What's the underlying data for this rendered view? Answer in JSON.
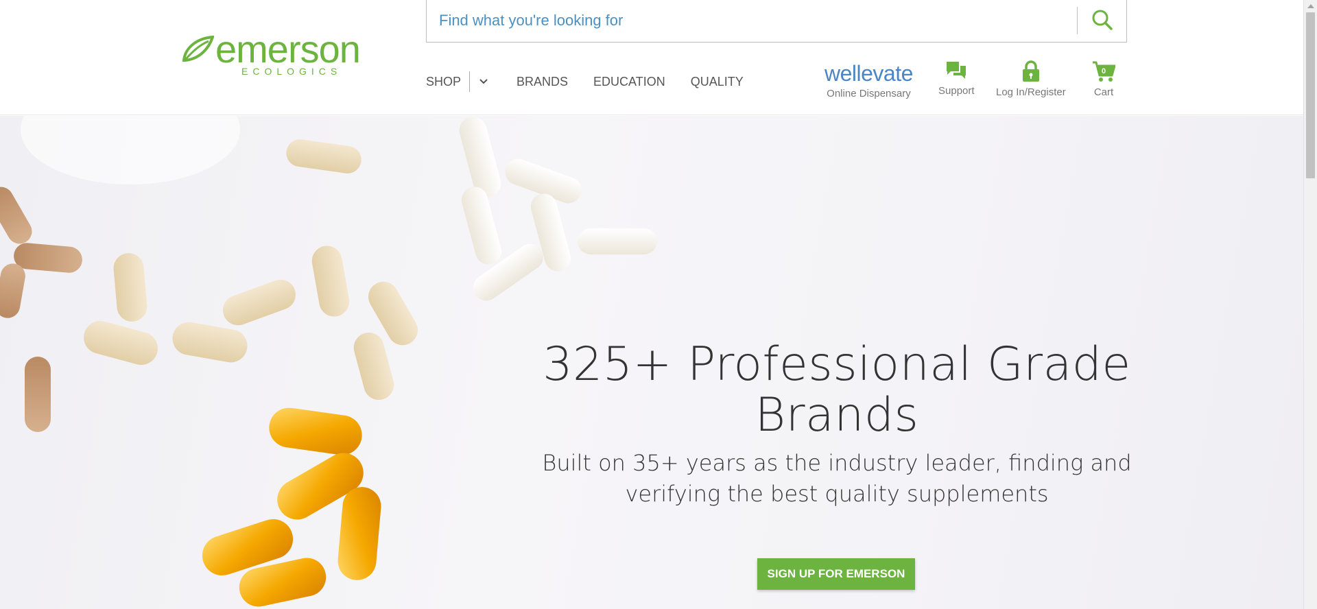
{
  "brand": {
    "name": "emerson",
    "tagline": "ECOLOGICS",
    "accent_color": "#6cb33f"
  },
  "search": {
    "placeholder": "Find what you're looking for",
    "icon": "search-icon"
  },
  "nav": {
    "items": [
      {
        "label": "SHOP"
      },
      {
        "label": "BRANDS"
      },
      {
        "label": "EDUCATION"
      },
      {
        "label": "QUALITY"
      }
    ],
    "shop_dropdown_icon": "chevron-down-icon"
  },
  "utility": {
    "wellevate": {
      "brand": "wellevate",
      "label": "Online Dispensary",
      "color": "#4a86c5"
    },
    "support": {
      "label": "Support",
      "icon": "chat-icon"
    },
    "login": {
      "label": "Log In/Register",
      "icon": "lock-icon"
    },
    "cart": {
      "label": "Cart",
      "count": "0",
      "icon": "cart-icon"
    }
  },
  "hero": {
    "title": "325+ Professional Grade Brands",
    "subtitle": "Built on 35+ years as the industry leader, finding and verifying the best quality supplements",
    "cta": "SIGN UP FOR EMERSON"
  }
}
